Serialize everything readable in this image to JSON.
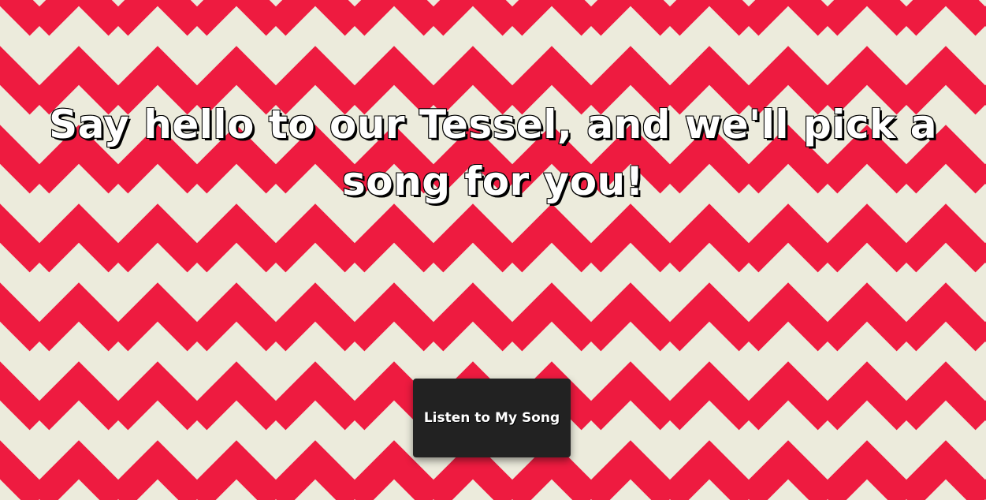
{
  "page": {
    "headline": "Say hello to our Tessel, and we'll pick a song for you!",
    "button_label": "Listen to My Song"
  },
  "colors": {
    "chevron_red": "#ee1b40",
    "chevron_cream": "#ecebdc",
    "button_bg": "#222222",
    "text": "#ffffff"
  }
}
